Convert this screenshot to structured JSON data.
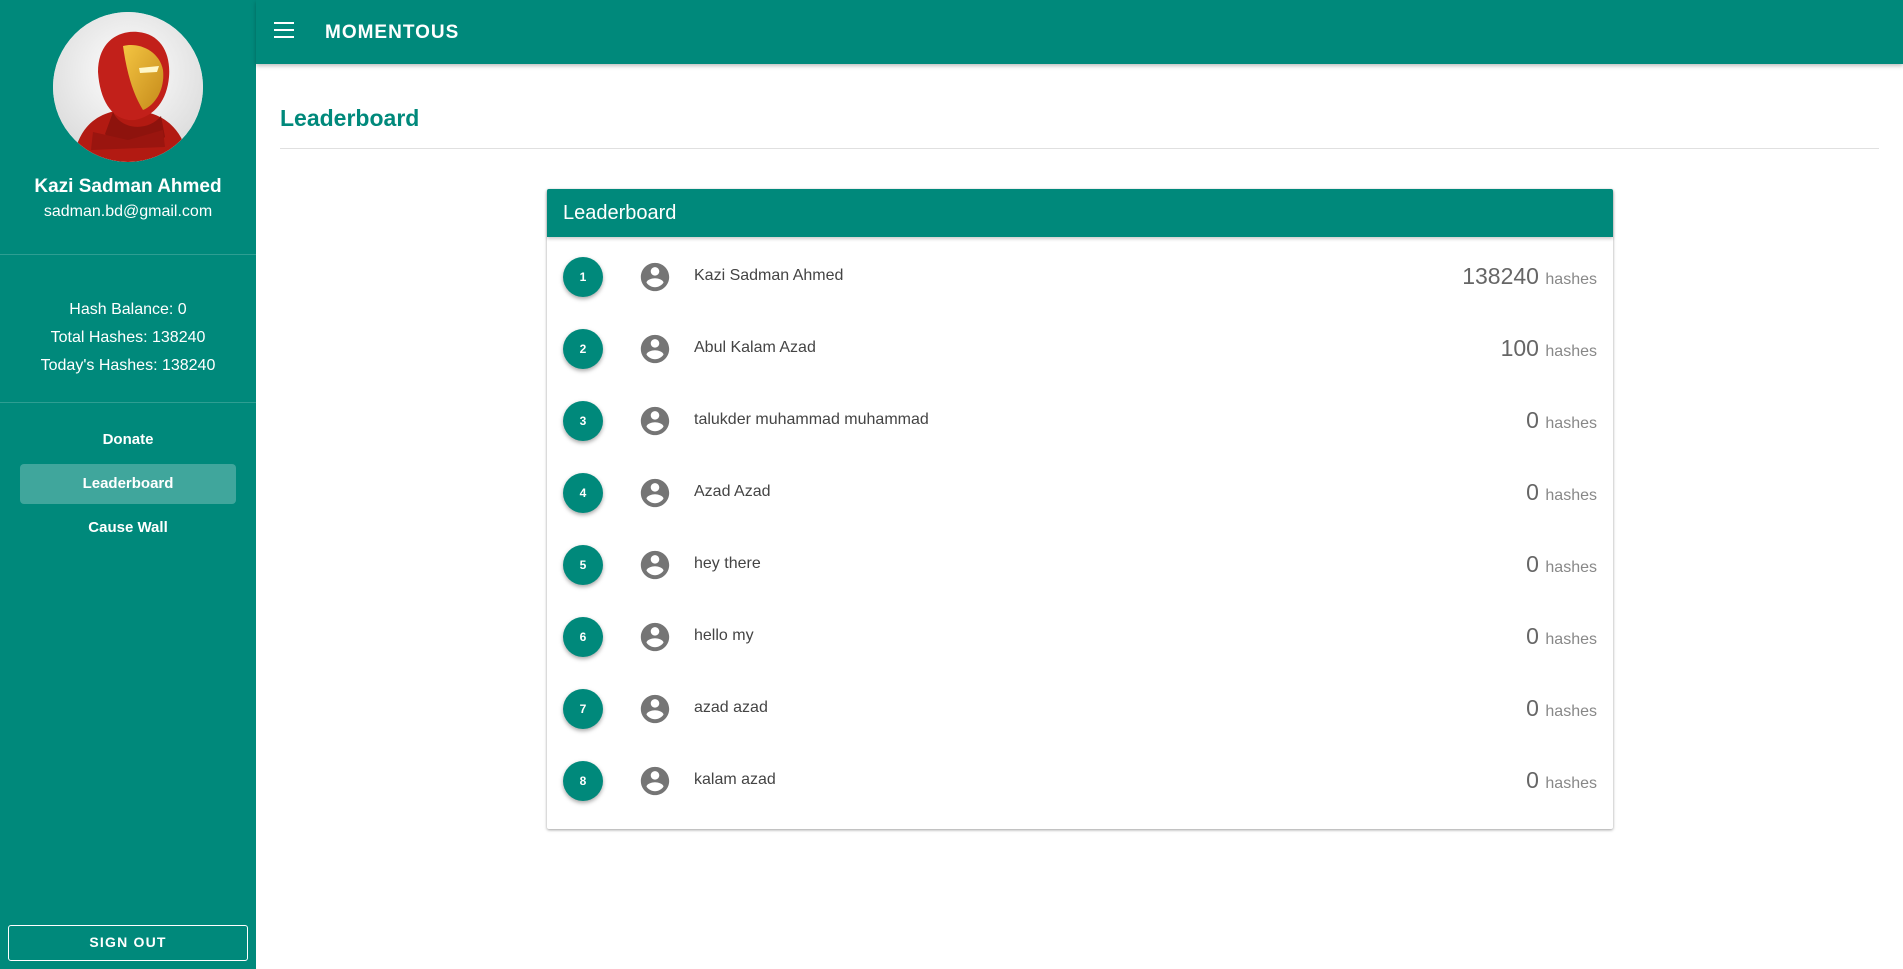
{
  "app": {
    "title": "MOMENTOUS"
  },
  "profile": {
    "name": "Kazi Sadman Ahmed",
    "email": "sadman.bd@gmail.com"
  },
  "stats": {
    "hash_balance": "Hash Balance: 0",
    "total_hashes": "Total Hashes: 138240",
    "todays_hashes": "Today's Hashes: 138240"
  },
  "nav": [
    {
      "label": "Donate",
      "active": false
    },
    {
      "label": "Leaderboard",
      "active": true
    },
    {
      "label": "Cause Wall",
      "active": false
    }
  ],
  "signout_label": "SIGN OUT",
  "page": {
    "title": "Leaderboard"
  },
  "leaderboard": {
    "header": "Leaderboard",
    "unit": "hashes",
    "rows": [
      {
        "rank": "1",
        "name": "Kazi Sadman Ahmed",
        "score": "138240"
      },
      {
        "rank": "2",
        "name": "Abul Kalam Azad",
        "score": "100"
      },
      {
        "rank": "3",
        "name": "talukder muhammad muhammad",
        "score": "0"
      },
      {
        "rank": "4",
        "name": "Azad Azad",
        "score": "0"
      },
      {
        "rank": "5",
        "name": "hey there",
        "score": "0"
      },
      {
        "rank": "6",
        "name": "hello my",
        "score": "0"
      },
      {
        "rank": "7",
        "name": "azad azad",
        "score": "0"
      },
      {
        "rank": "8",
        "name": "kalam azad",
        "score": "0"
      }
    ]
  },
  "colors": {
    "primary": "#00897b",
    "text": "#444444",
    "muted": "#888888"
  },
  "icons": {
    "menu": "menu-icon",
    "user": "account-circle-icon",
    "avatar": "iron-man-avatar"
  }
}
